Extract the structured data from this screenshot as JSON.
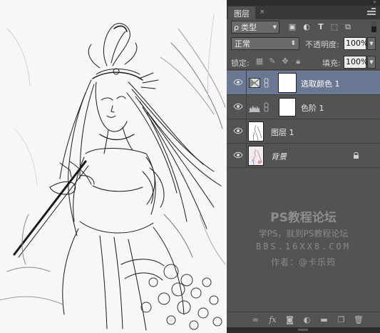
{
  "panel": {
    "tab_label": "图层",
    "tab_close": "×",
    "collapse_arrows": "»",
    "filter": {
      "search_glyph": "ρ",
      "kind_label": "类型",
      "icons": [
        "image-filter-icon",
        "adjustment-filter-icon",
        "type-filter-icon",
        "shape-filter-icon",
        "smart-object-filter-icon"
      ]
    },
    "blend_mode": "正常",
    "opacity_label": "不透明度:",
    "opacity_value": "100%",
    "lock_label": "锁定:",
    "fill_label": "填充:",
    "fill_value": "100%",
    "lock_icons": [
      "lock-transparent-icon",
      "lock-pixels-icon",
      "lock-position-icon",
      "lock-all-icon"
    ]
  },
  "layers": [
    {
      "name": "选取颜色 1",
      "type": "adjustment",
      "adjustment_icon": "selective-color-icon",
      "selected": true,
      "visible": true
    },
    {
      "name": "色阶 1",
      "type": "adjustment",
      "adjustment_icon": "levels-icon",
      "selected": false,
      "visible": true
    },
    {
      "name": "图层 1",
      "type": "pixel",
      "selected": false,
      "visible": true
    },
    {
      "name": "背景",
      "type": "background",
      "locked": true,
      "selected": false,
      "visible": true
    }
  ],
  "watermark": {
    "line1": "PS教程论坛",
    "line2": "学PS，就到PS教程论坛",
    "line3": "BBS.16XX8.COM",
    "line4": "作者：@卡乐筠"
  },
  "bottom_icons": [
    "link-layers-icon",
    "fx-icon",
    "add-mask-icon",
    "new-adjustment-icon",
    "new-group-icon",
    "new-layer-icon",
    "delete-layer-icon"
  ],
  "bottom_labels": {
    "fx": "fx"
  },
  "colors": {
    "panel_bg": "#535353",
    "selected_layer": "#6a7893",
    "tab_bar": "#383838"
  }
}
